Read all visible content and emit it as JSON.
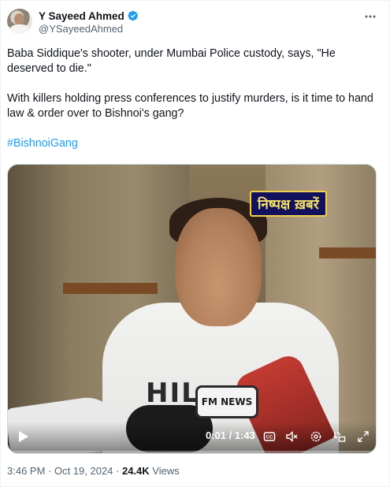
{
  "author": {
    "name": "Y Sayeed Ahmed",
    "handle": "@YSayeedAhmed",
    "verified": true
  },
  "tweet": {
    "paragraph1": "Baba Siddique's shooter, under Mumbai Police custody, says, \"He deserved to die.\"",
    "paragraph2": "With killers holding press conferences to justify murders, is it time to hand law & order over to Bishnoi's gang?",
    "hashtag": "#BishnoiGang"
  },
  "video": {
    "overlay_logo": "निष्पक्ष ख़बरें",
    "shirt_print": "HIL",
    "mic_label": "FM NEWS",
    "time": "0:01 / 1:43",
    "progress_fraction": 0.01
  },
  "meta": {
    "time_date": "3:46 PM · Oct 19, 2024 · ",
    "views_count": "24.4K",
    "views_label": " Views"
  },
  "colors": {
    "accent": "#1d9bf0",
    "text_primary": "#0f1419",
    "text_secondary": "#536471"
  },
  "icons": [
    "more-icon",
    "verified-icon",
    "play-icon",
    "captions-icon",
    "volume-icon",
    "settings-icon",
    "pip-icon",
    "fullscreen-icon"
  ]
}
